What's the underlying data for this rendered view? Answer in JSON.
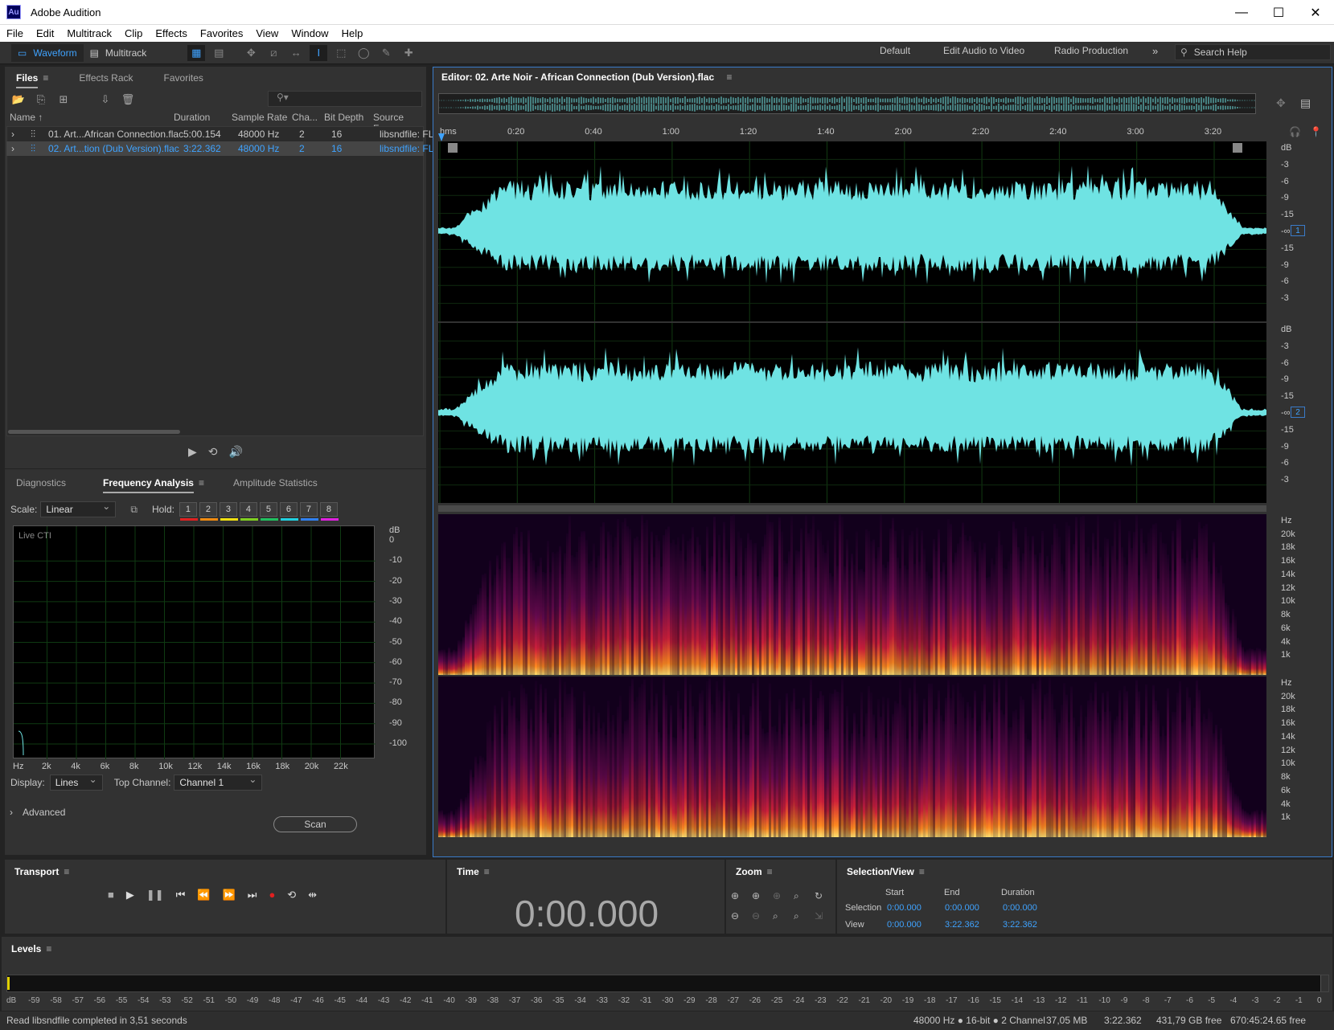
{
  "window": {
    "title": "Adobe Audition",
    "logo": "Au"
  },
  "menu": [
    "File",
    "Edit",
    "Multitrack",
    "Clip",
    "Effects",
    "Favorites",
    "View",
    "Window",
    "Help"
  ],
  "toolbar": {
    "waveform_label": "Waveform",
    "multitrack_label": "Multitrack"
  },
  "workspaces": [
    "Default",
    "Edit Audio to Video",
    "Radio Production"
  ],
  "search_help": {
    "placeholder": "Search Help"
  },
  "files_panel": {
    "tabs": [
      "Files",
      "Effects Rack",
      "Favorites"
    ],
    "columns": [
      "Name",
      "Duration",
      "Sample Rate",
      "Cha...",
      "Bit Depth",
      "Source Form"
    ],
    "rows": [
      {
        "name": "01. Art...African Connection.flac",
        "duration": "5:00.154",
        "sample_rate": "48000 Hz",
        "channels": "2",
        "bit_depth": "16",
        "source": "libsndfile: FL"
      },
      {
        "name": "02. Art...tion (Dub Version).flac",
        "duration": "3:22.362",
        "sample_rate": "48000 Hz",
        "channels": "2",
        "bit_depth": "16",
        "source": "libsndfile: FL"
      }
    ]
  },
  "freq_panel": {
    "tabs": [
      "Diagnostics",
      "Frequency Analysis",
      "Amplitude Statistics"
    ],
    "scale_label": "Scale:",
    "scale_value": "Linear",
    "hold_label": "Hold:",
    "hold_buttons": [
      "1",
      "2",
      "3",
      "4",
      "5",
      "6",
      "7",
      "8"
    ],
    "hold_colors": [
      "#e02020",
      "#f08a10",
      "#f0e010",
      "#80d020",
      "#20c060",
      "#20d0e0",
      "#3080f0",
      "#e020e0"
    ],
    "graph_label": "Live CTI",
    "db_axis": [
      "dB",
      "0",
      "-10",
      "-20",
      "-30",
      "-40",
      "-50",
      "-60",
      "-70",
      "-80",
      "-90",
      "-100"
    ],
    "hz_axis": [
      "Hz",
      "2k",
      "4k",
      "6k",
      "8k",
      "10k",
      "12k",
      "14k",
      "16k",
      "18k",
      "20k",
      "22k"
    ],
    "display_label": "Display:",
    "display_value": "Lines",
    "top_channel_label": "Top Channel:",
    "top_channel_value": "Channel 1",
    "scan_label": "Scan",
    "advanced_label": "Advanced"
  },
  "editor": {
    "title": "Editor: 02. Arte Noir - African Connection (Dub Version).flac",
    "ruler": [
      "hms",
      "0:20",
      "0:40",
      "1:00",
      "1:20",
      "1:40",
      "2:00",
      "2:20",
      "2:40",
      "3:00",
      "3:20"
    ],
    "db_axis": [
      "dB",
      "-3",
      "-6",
      "-9",
      "-15",
      "-∞",
      "-15",
      "-9",
      "-6",
      "-3"
    ],
    "hz_axis": [
      "Hz",
      "20k",
      "18k",
      "16k",
      "14k",
      "12k",
      "10k",
      "8k",
      "6k",
      "4k",
      "1k"
    ],
    "channel_badges": [
      "1",
      "2"
    ],
    "wave_color": "#6fe3e3"
  },
  "transport": {
    "title": "Transport"
  },
  "time": {
    "title": "Time",
    "value": "0:00.000"
  },
  "zoom": {
    "title": "Zoom"
  },
  "selection_view": {
    "title": "Selection/View",
    "headers": [
      "Start",
      "End",
      "Duration"
    ],
    "rows": [
      {
        "label": "Selection",
        "start": "0:00.000",
        "end": "0:00.000",
        "duration": "0:00.000"
      },
      {
        "label": "View",
        "start": "0:00.000",
        "end": "3:22.362",
        "duration": "3:22.362"
      }
    ]
  },
  "levels": {
    "title": "Levels",
    "scale": [
      "dB",
      "-59",
      "-58",
      "-57",
      "-56",
      "-55",
      "-54",
      "-53",
      "-52",
      "-51",
      "-50",
      "-49",
      "-48",
      "-47",
      "-46",
      "-45",
      "-44",
      "-43",
      "-42",
      "-41",
      "-40",
      "-39",
      "-38",
      "-37",
      "-36",
      "-35",
      "-34",
      "-33",
      "-32",
      "-31",
      "-30",
      "-29",
      "-28",
      "-27",
      "-26",
      "-25",
      "-24",
      "-23",
      "-22",
      "-21",
      "-20",
      "-19",
      "-18",
      "-17",
      "-16",
      "-15",
      "-14",
      "-13",
      "-12",
      "-11",
      "-10",
      "-9",
      "-8",
      "-7",
      "-6",
      "-5",
      "-4",
      "-3",
      "-2",
      "-1",
      "0"
    ]
  },
  "status": {
    "message": "Read libsndfile completed in 3,51 seconds",
    "format": "48000 Hz ● 16-bit ● 2 Channel",
    "size": "37,05 MB",
    "duration": "3:22.362",
    "free": "431,79 GB free",
    "free_time": "670:45:24.65 free"
  }
}
